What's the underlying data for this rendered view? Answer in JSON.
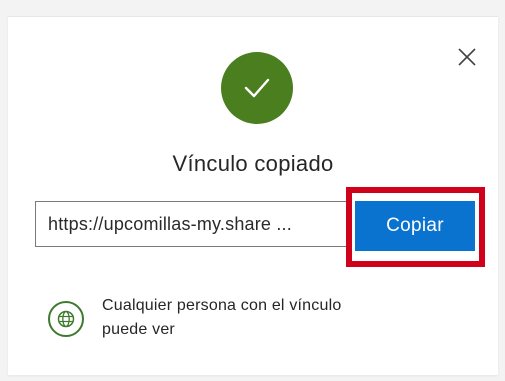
{
  "dialog": {
    "close_label": "×",
    "status_icon": "checkmark-icon",
    "title": "Vínculo copiado",
    "link": {
      "value": "https://upcomillas-my.share ..."
    },
    "copy_button_label": "Copiar",
    "permission": {
      "icon": "globe-icon",
      "line1": "Cualquier persona con el vínculo",
      "line2": "puede ver"
    }
  },
  "colors": {
    "success_green": "#4a7e1e",
    "primary_blue": "#0a72cf",
    "highlight_red": "#d0021b"
  }
}
